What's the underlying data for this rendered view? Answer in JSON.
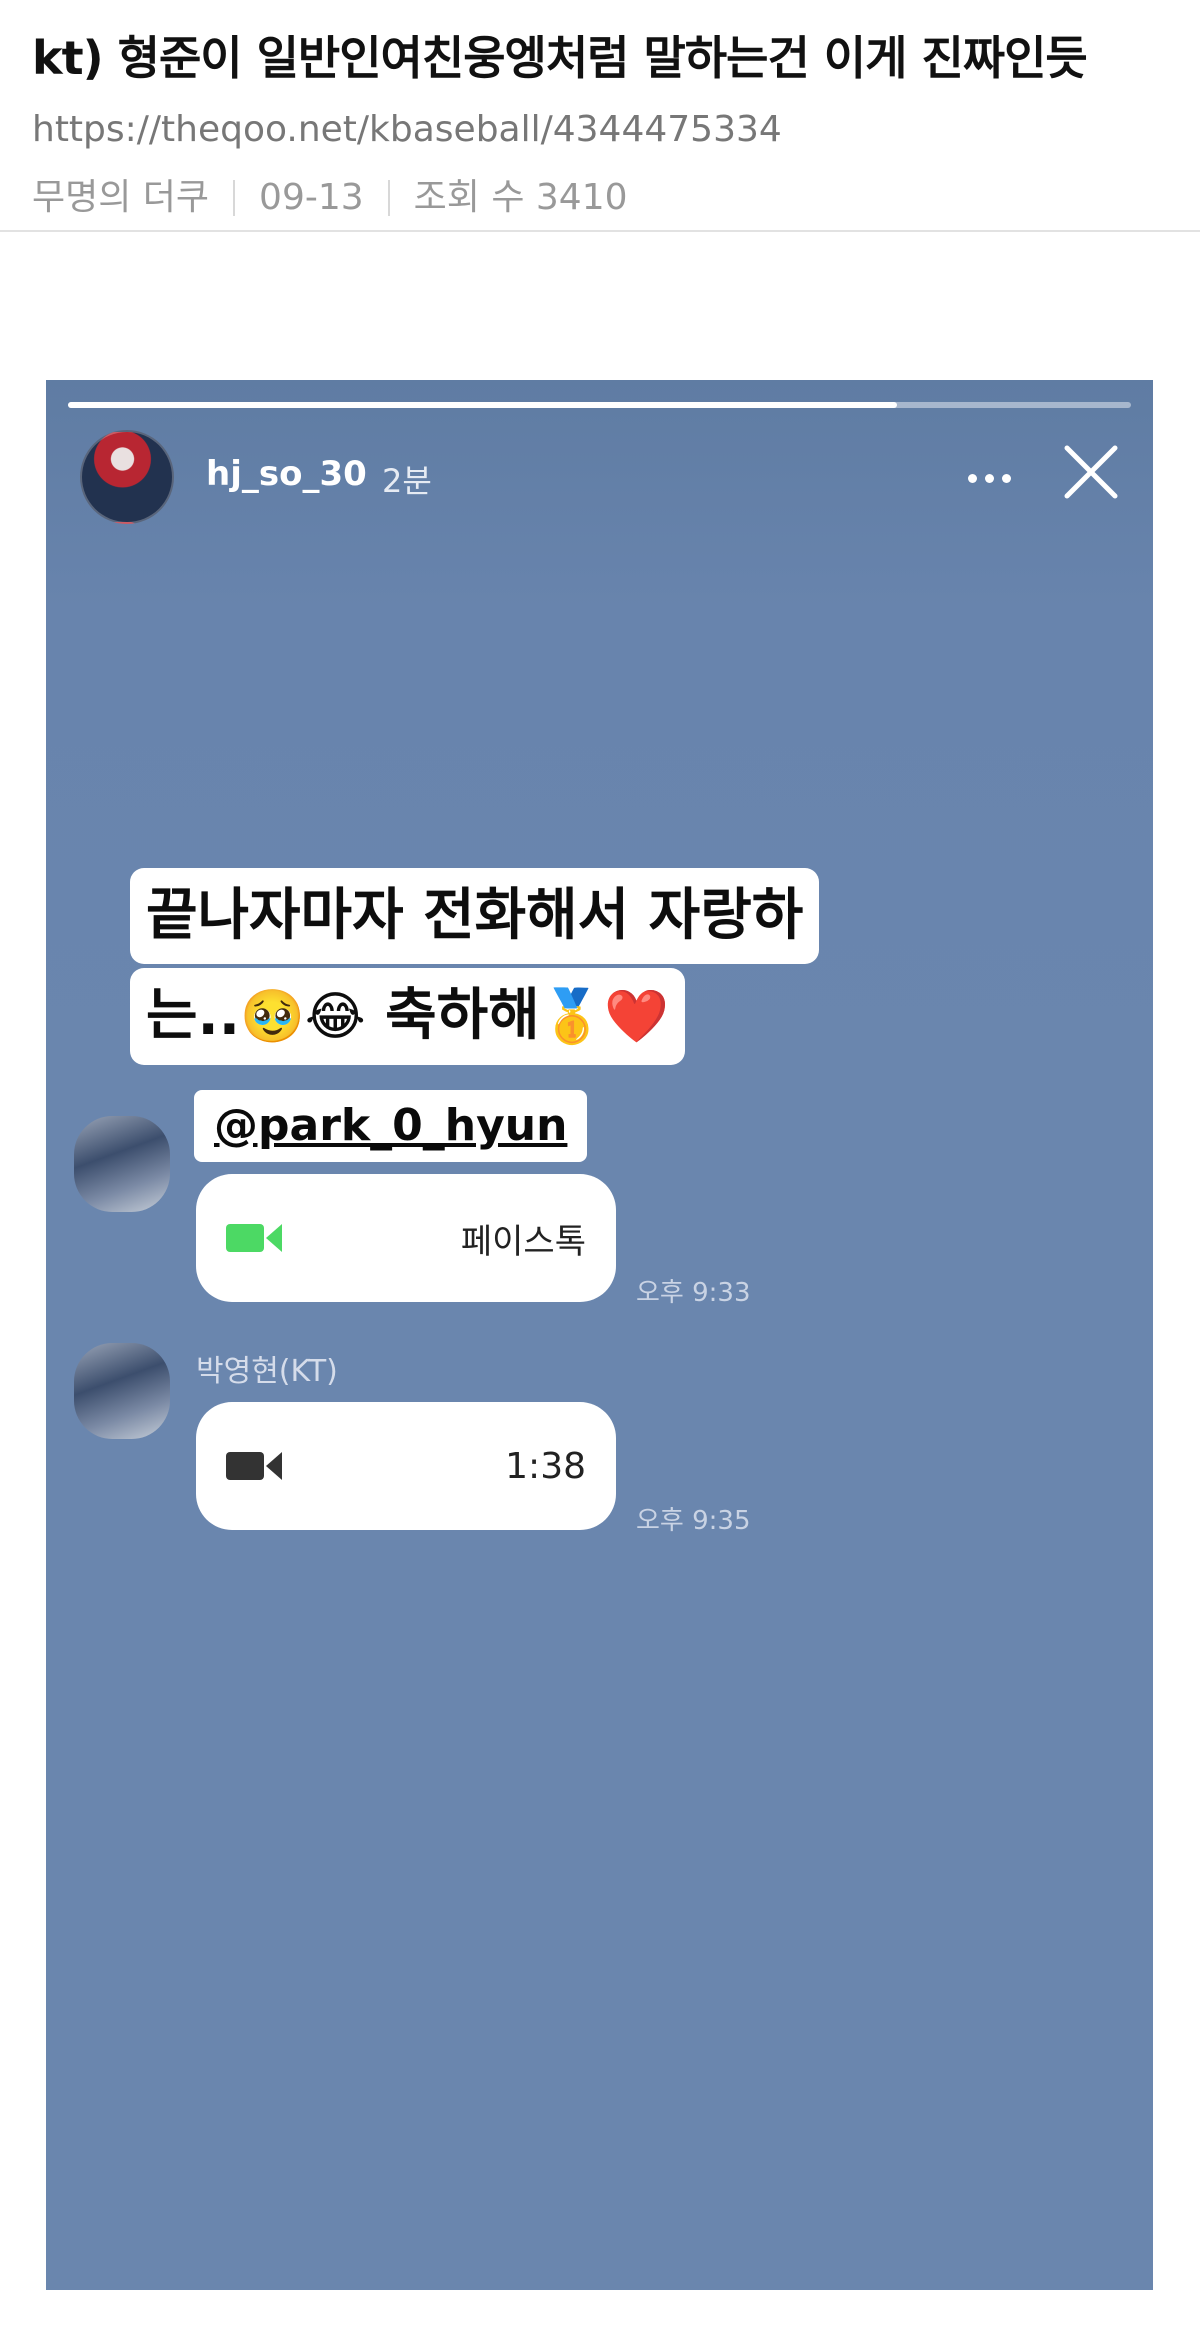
{
  "post": {
    "title": "kt) 형준이 일반인여친웅엥처럼 말하는건 이게 진짜인듯",
    "url": "https://theqoo.net/kbaseball/4344475334",
    "author": "무명의 더쿠",
    "date": "09-13",
    "views_label": "조회 수 3410"
  },
  "story": {
    "progress": 0.78,
    "username": "hj_so_30",
    "time_ago": "2분",
    "caption_line1": "끝나자마자 전화해서 자랑하",
    "caption_line2_text": "는..",
    "caption_line2_emoji_a": "🥹😂",
    "caption_line2_text_b": "축하해",
    "caption_line2_emoji_b": "🥇❤️",
    "mention": "@park_0_hyun",
    "colors": {
      "background": "#6a86ae",
      "facetime_green": "#4cd964",
      "video_gray": "#333333"
    }
  },
  "chat": {
    "msg1": {
      "icon": "facetime-video-icon",
      "label": "페이스톡",
      "time": "오후 9:33"
    },
    "msg2": {
      "sender": "박영현(KT)",
      "icon": "video-camera-icon",
      "duration": "1:38",
      "time": "오후 9:35"
    }
  }
}
